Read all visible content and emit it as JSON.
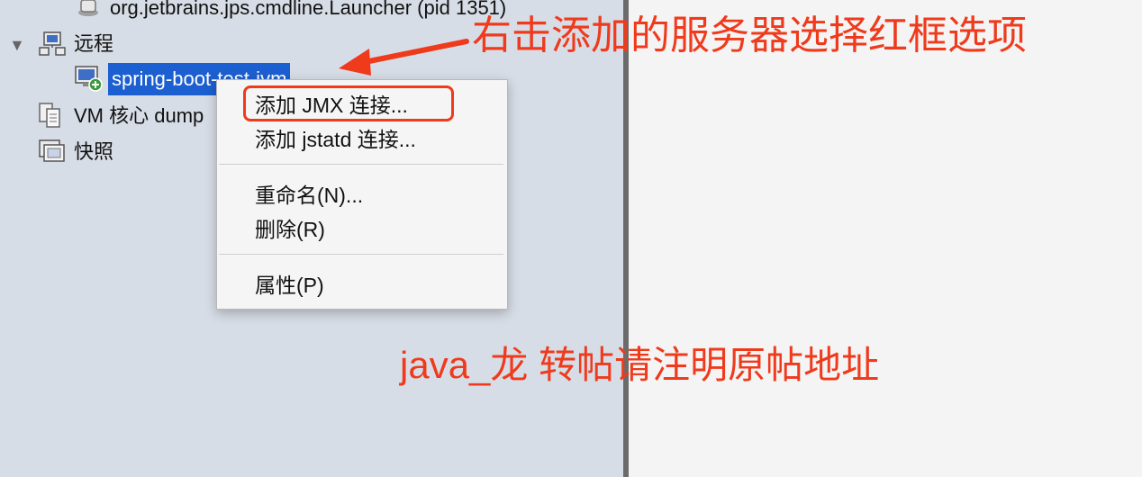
{
  "tree": {
    "launcher_label": "org.jetbrains.jps.cmdline.Launcher (pid 1351)",
    "remote_label": "远程",
    "selected_host_label": "spring-boot-test-jvm",
    "vm_core_label": "VM 核心 dump",
    "snapshot_label": "快照"
  },
  "context_menu": {
    "items": [
      {
        "label": "添加 JMX 连接..."
      },
      {
        "label": "添加 jstatd 连接..."
      },
      {
        "label": "重命名(N)..."
      },
      {
        "label": "删除(R)"
      },
      {
        "label": "属性(P)"
      }
    ]
  },
  "annotations": {
    "top": "右击添加的服务器选择红框选项",
    "bottom": "java_龙 转帖请注明原帖地址"
  },
  "colors": {
    "accent": "#ef3a1c",
    "selection": "#1c5fd1",
    "pane_bg": "#d7dde6"
  }
}
